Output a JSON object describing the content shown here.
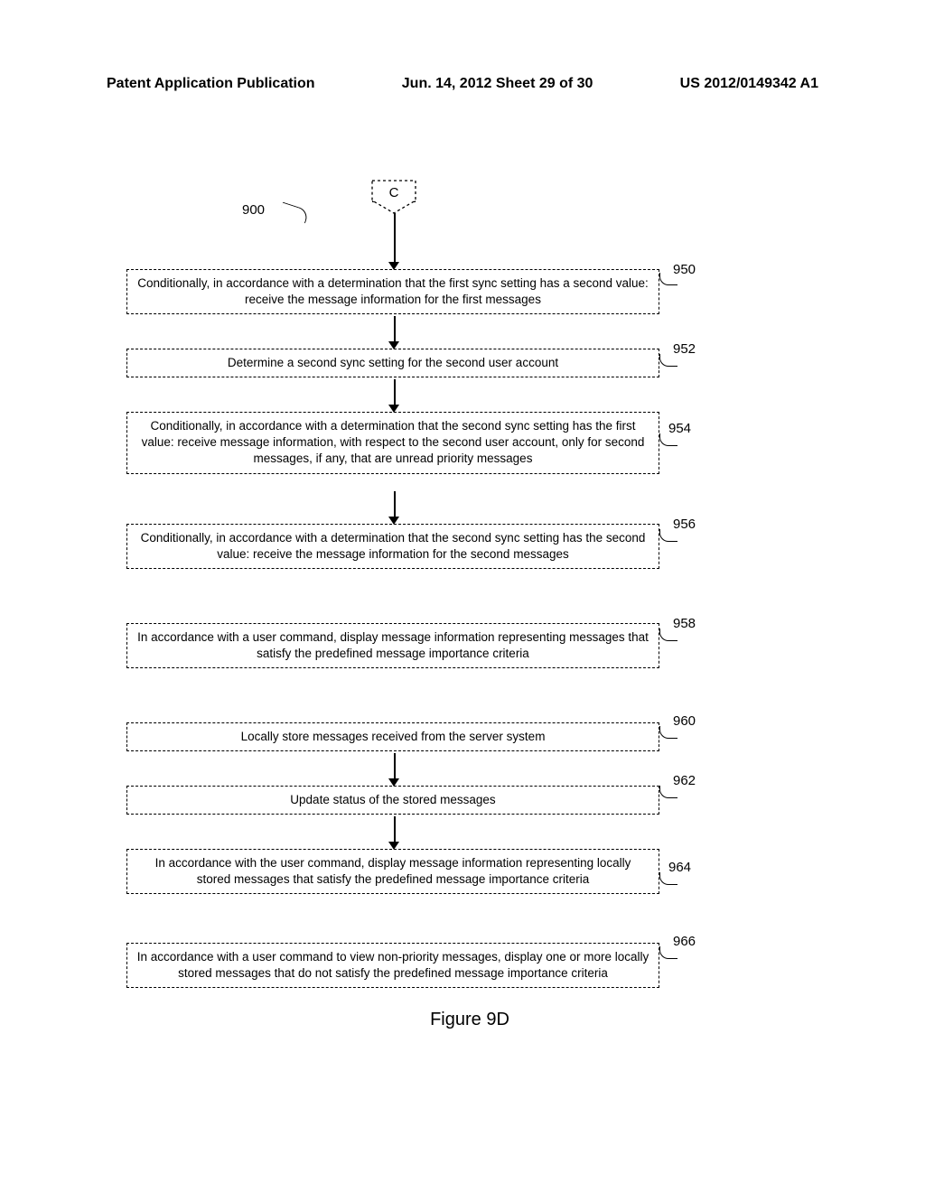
{
  "header": {
    "left": "Patent Application Publication",
    "center": "Jun. 14, 2012  Sheet 29 of 30",
    "right": "US 2012/0149342 A1"
  },
  "connector_label": "C",
  "ref_900": "900",
  "boxes": {
    "b950": {
      "text": "Conditionally, in accordance with a determination that the first sync setting has a second value: receive the message information for the first messages",
      "ref": "950"
    },
    "b952": {
      "text": "Determine a second sync setting for the second user account",
      "ref": "952"
    },
    "b954": {
      "text": "Conditionally, in accordance with a determination that the second sync setting has the first value: receive message information, with respect to the second user account, only for second messages, if any, that are unread priority messages",
      "ref": "954"
    },
    "b956": {
      "text": "Conditionally, in accordance with a determination that the second sync setting has the second value: receive the message information for the second messages",
      "ref": "956"
    },
    "b958": {
      "text": "In accordance with a user command, display message information representing messages that satisfy the predefined message importance criteria",
      "ref": "958"
    },
    "b960": {
      "text": "Locally store messages received from the server system",
      "ref": "960"
    },
    "b962": {
      "text": "Update status of the stored messages",
      "ref": "962"
    },
    "b964": {
      "text": "In accordance with the user command, display message information representing locally stored messages that satisfy the predefined message importance criteria",
      "ref": "964"
    },
    "b966": {
      "text": "In accordance with a user command to view non-priority messages, display one or more locally stored messages that do not satisfy the predefined message importance criteria",
      "ref": "966"
    }
  },
  "figure_title": "Figure 9D"
}
